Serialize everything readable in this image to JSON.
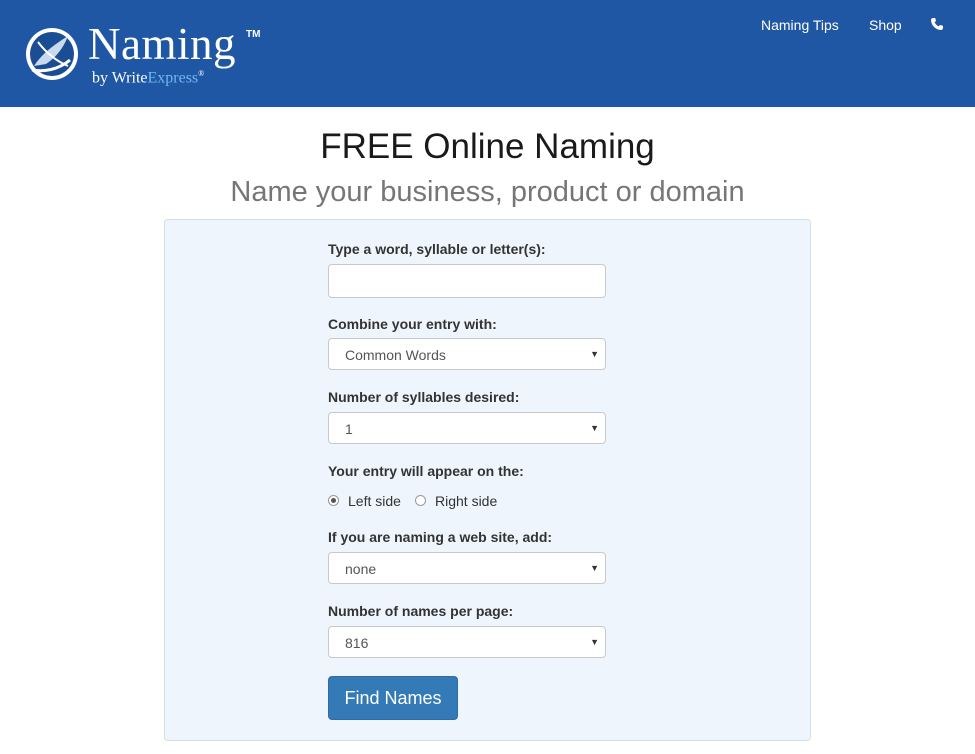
{
  "header": {
    "logo_word": "Naming",
    "logo_tm": "TM",
    "logo_by": "by Write",
    "logo_express": "Express",
    "logo_reg": "®",
    "nav": [
      "Naming Tips",
      "Shop"
    ],
    "phone_icon": "phone-icon"
  },
  "main": {
    "title": "FREE Online Naming",
    "subtitle": "Name your business, product or domain"
  },
  "form": {
    "word_label": "Type a word, syllable or letter(s):",
    "word_value": "",
    "combine_label": "Combine your entry with:",
    "combine_value": "Common Words",
    "syllables_label": "Number of syllables desired:",
    "syllables_value": "1",
    "position_label": "Your entry will appear on the:",
    "position_options": [
      "Left side",
      "Right side"
    ],
    "position_selected": "Left side",
    "website_label": "If you are naming a web site, add:",
    "website_value": "none",
    "names_label": "Number of names per page:",
    "names_value": "816",
    "submit_label": "Find Names"
  },
  "colors": {
    "navbar": "#2057a4",
    "panel": "#eef5fc",
    "button": "#337ab7"
  }
}
